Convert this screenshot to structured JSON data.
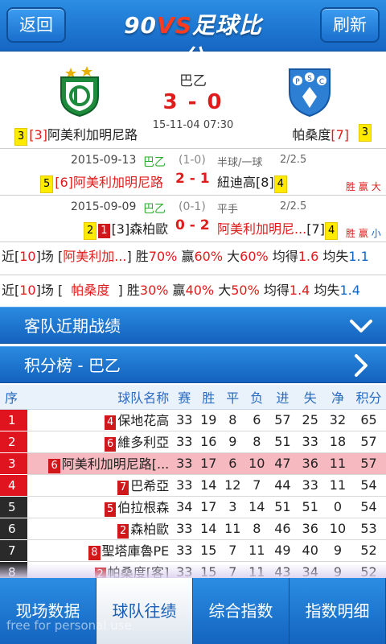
{
  "header": {
    "back_label": "返回",
    "logo_prefix": "90",
    "logo_vs": "VS",
    "logo_suffix": "足球比分",
    "refresh_label": "刷新"
  },
  "match": {
    "league": "巴乙",
    "score": "3 - 0",
    "datetime": "15-11-04 07:30",
    "home": {
      "rank_outer": "3",
      "rank_inner": "[3]",
      "name": "阿美利加明尼路"
    },
    "away": {
      "name": "帕桑度",
      "rank_inner": "[7]",
      "rank_outer": "3"
    }
  },
  "h2h": [
    {
      "date": "2015-09-13",
      "league": "巴乙",
      "halftime": "(1-0)",
      "handicap": "半球/一球",
      "line": "2/2.5",
      "home_box": "5",
      "home_rank": "[6]",
      "home": "阿美利加明尼路",
      "score": "2 - 1",
      "away": "紐迪高",
      "away_rank": "[8]",
      "away_box": "4",
      "result": "胜",
      "handicap_result": "赢",
      "ou_result": "大"
    },
    {
      "date": "2015-09-09",
      "league": "巴乙",
      "halftime": "(0-1)",
      "handicap": "平手",
      "line": "2/2.5",
      "home_box": "2",
      "home_redbox": "1",
      "home_rank": "[3]",
      "home": "森柏歐",
      "score": "0 - 2",
      "away": "阿美利加明尼...",
      "away_rank": "[7]",
      "away_box": "4",
      "result": "胜",
      "handicap_result": "赢",
      "ou_result": "小"
    }
  ],
  "recent": [
    {
      "prefix": "近[",
      "count": "10",
      "mid": "]场 [",
      "team": "阿美利加...",
      "close": "] 胜",
      "win": "70%",
      "l1": "赢",
      "cover": "60%",
      "l2": "大",
      "over": "60%",
      "l3": "均得",
      "gf": "1.6",
      "l4": "均失",
      "ga": "1.1"
    },
    {
      "prefix": "近[",
      "count": "10",
      "mid": "]场 [",
      "team": "帕桑度",
      "close": "] 胜",
      "win": "30%",
      "l1": "赢",
      "cover": "40%",
      "l2": "大",
      "over": "50%",
      "l3": "均得",
      "gf": "1.4",
      "l4": "均失",
      "ga": "1.4"
    }
  ],
  "sections": {
    "away_recent": "客队近期战绩",
    "standings": "积分榜 - 巴乙"
  },
  "standings": {
    "headers": [
      "序",
      "球队名称",
      "赛",
      "胜",
      "平",
      "负",
      "进",
      "失",
      "净",
      "积分"
    ],
    "rows": [
      {
        "pos": "1",
        "pos_color": "#e0141e",
        "tag": "4",
        "team": "保地花高",
        "p": "33",
        "w": "19",
        "d": "8",
        "l": "6",
        "gf": "57",
        "ga": "25",
        "gd": "32",
        "pts": "65"
      },
      {
        "pos": "2",
        "pos_color": "#e0141e",
        "tag": "6",
        "team": "維多利亞",
        "p": "33",
        "w": "16",
        "d": "9",
        "l": "8",
        "gf": "51",
        "ga": "33",
        "gd": "18",
        "pts": "57"
      },
      {
        "pos": "3",
        "pos_color": "#e0141e",
        "tag": "6",
        "team": "阿美利加明尼路[...",
        "p": "33",
        "w": "17",
        "d": "6",
        "l": "10",
        "gf": "47",
        "ga": "36",
        "gd": "11",
        "pts": "57"
      },
      {
        "pos": "4",
        "pos_color": "#e0141e",
        "tag": "7",
        "team": "巴希亞",
        "p": "33",
        "w": "14",
        "d": "12",
        "l": "7",
        "gf": "44",
        "ga": "33",
        "gd": "11",
        "pts": "54"
      },
      {
        "pos": "5",
        "pos_color": "#2a2a2a",
        "tag": "5",
        "team": "伯拉根森",
        "p": "34",
        "w": "17",
        "d": "3",
        "l": "14",
        "gf": "51",
        "ga": "51",
        "gd": "0",
        "pts": "54"
      },
      {
        "pos": "6",
        "pos_color": "#2a2a2a",
        "tag": "2",
        "team": "森柏歐",
        "p": "33",
        "w": "14",
        "d": "11",
        "l": "8",
        "gf": "46",
        "ga": "36",
        "gd": "10",
        "pts": "53"
      },
      {
        "pos": "7",
        "pos_color": "#2a2a2a",
        "tag": "8",
        "team": "聖塔庫魯PE",
        "p": "33",
        "w": "15",
        "d": "7",
        "l": "11",
        "gf": "49",
        "ga": "40",
        "gd": "9",
        "pts": "52"
      },
      {
        "pos": "8",
        "pos_color": "#2a2a2a",
        "tag": "2",
        "team": "帕桑度[客]",
        "p": "33",
        "w": "15",
        "d": "7",
        "l": "11",
        "gf": "43",
        "ga": "34",
        "gd": "9",
        "pts": "52"
      }
    ]
  },
  "tabs": [
    "现场数据",
    "球队往绩",
    "综合指数",
    "指数明细"
  ],
  "watermark": "free for personal use"
}
